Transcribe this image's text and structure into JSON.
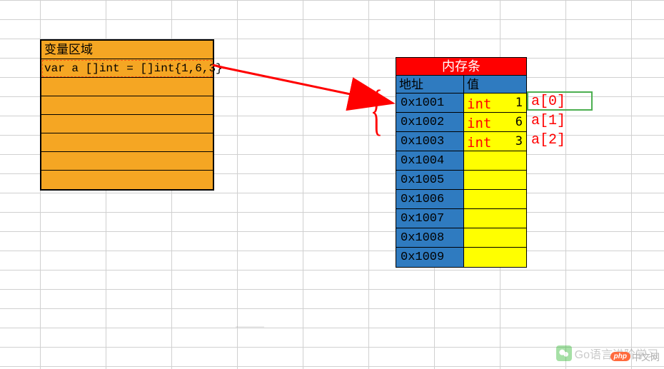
{
  "var_region": {
    "title": "变量区域",
    "code": "var a []int = []int{1,6,3}"
  },
  "memory": {
    "title": "内存条",
    "col_addr": "地址",
    "col_val": "值",
    "rows": [
      {
        "addr": "0x1001",
        "type": "int",
        "val": "1",
        "idx": "a[0]"
      },
      {
        "addr": "0x1002",
        "type": "int",
        "val": "6",
        "idx": "a[1]"
      },
      {
        "addr": "0x1003",
        "type": "int",
        "val": "3",
        "idx": "a[2]"
      },
      {
        "addr": "0x1004",
        "type": "",
        "val": "",
        "idx": ""
      },
      {
        "addr": "0x1005",
        "type": "",
        "val": "",
        "idx": ""
      },
      {
        "addr": "0x1006",
        "type": "",
        "val": "",
        "idx": ""
      },
      {
        "addr": "0x1007",
        "type": "",
        "val": "",
        "idx": ""
      },
      {
        "addr": "0x1008",
        "type": "",
        "val": "",
        "idx": ""
      },
      {
        "addr": "0x1009",
        "type": "",
        "val": "",
        "idx": ""
      }
    ]
  },
  "watermark": {
    "channel": "Go语言进阶学习",
    "site": "中文网",
    "php": "php"
  },
  "colors": {
    "orange": "#f5a623",
    "blue": "#2f7bc0",
    "red": "#ff0000",
    "yellow": "#ffff00",
    "green_box": "#4caf50"
  }
}
